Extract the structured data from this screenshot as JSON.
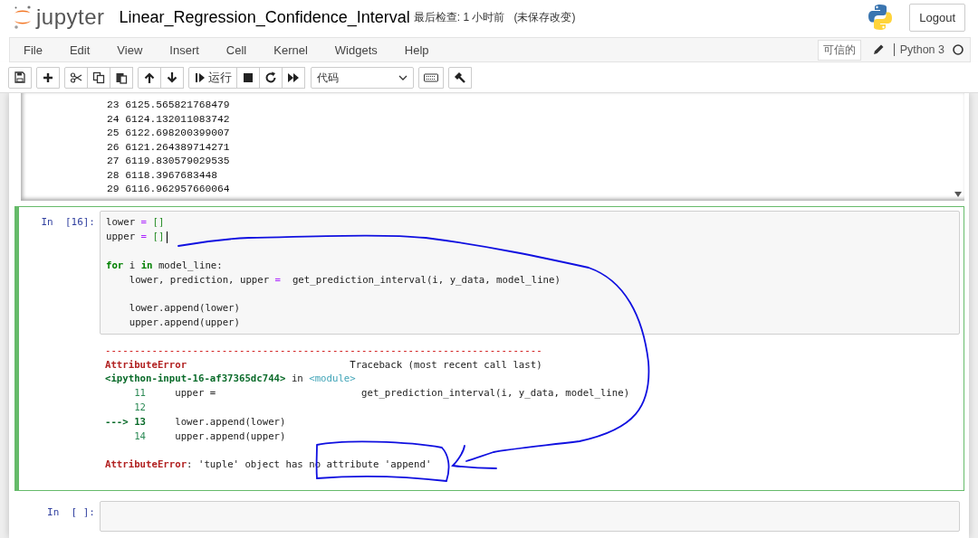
{
  "header": {
    "logo_text": "jupyter",
    "notebook_title": "Linear_Regression_Confidence_Interval",
    "checkpoint": "最后检查: 1 小时前",
    "unsaved": "(未保存改变)",
    "logout": "Logout"
  },
  "menu": {
    "items": [
      "File",
      "Edit",
      "View",
      "Insert",
      "Cell",
      "Kernel",
      "Widgets",
      "Help"
    ],
    "trusted": "可信的",
    "kernel_name": "Python 3",
    "kernel_busy": false
  },
  "toolbar": {
    "run_label": "运行",
    "cell_type": "代码"
  },
  "cells": [
    {
      "kind": "output_scroll",
      "output": [
        "23 6125.565821768479",
        "24 6124.132011083742",
        "25 6122.698200399007",
        "26 6121.264389714271",
        "27 6119.830579029535",
        "28 6118.3967683448",
        "29 6116.962957660064"
      ]
    },
    {
      "kind": "code",
      "selected": true,
      "prompt": "In  [16]:",
      "code": [
        {
          "kind": "line",
          "tokens": [
            {
              "text": "lower",
              "kind": "name"
            },
            {
              "text": " = ",
              "kind": "op"
            },
            {
              "text": "[]",
              "kind": "bracket"
            }
          ]
        },
        {
          "kind": "line",
          "tokens": [
            {
              "text": "upper",
              "kind": "name"
            },
            {
              "text": " = ",
              "kind": "op"
            },
            {
              "text": "[]",
              "kind": "bracket"
            }
          ]
        },
        {
          "kind": "blank"
        },
        {
          "kind": "line",
          "tokens": [
            {
              "text": "for",
              "kind": "keyword"
            },
            {
              "text": " i ",
              "kind": "name"
            },
            {
              "text": "in",
              "kind": "keyword"
            },
            {
              "text": " model_line:",
              "kind": "name"
            }
          ]
        },
        {
          "kind": "line",
          "tokens": [
            {
              "text": "    lower, prediction, upper ",
              "kind": "name"
            },
            {
              "text": "=",
              "kind": "op"
            },
            {
              "text": "  get_prediction_interval(i, y_data, model_line)",
              "kind": "name"
            }
          ]
        },
        {
          "kind": "blank"
        },
        {
          "kind": "line",
          "tokens": [
            {
              "text": "    lower.append(lower)",
              "kind": "name"
            }
          ]
        },
        {
          "kind": "line",
          "tokens": [
            {
              "text": "    upper.append(upper)",
              "kind": "name"
            }
          ]
        }
      ],
      "traceback": [
        {
          "kind": "line",
          "tokens": [
            {
              "text": "---------------------------------------------------------------------------",
              "kind": "rule"
            }
          ]
        },
        {
          "kind": "line",
          "tokens": [
            {
              "text": "AttributeError",
              "kind": "error"
            },
            {
              "text": "                            Traceback (most recent call last)",
              "kind": "name"
            }
          ]
        },
        {
          "kind": "line",
          "tokens": [
            {
              "text": "<ipython-input-16-af37365dc744>",
              "kind": "file"
            },
            {
              "text": " in ",
              "kind": "name"
            },
            {
              "text": "<module>",
              "kind": "module"
            }
          ]
        },
        {
          "kind": "line",
          "tokens": [
            {
              "text": "     11",
              "kind": "lineno"
            },
            {
              "text": "     upper =                         get_prediction_interval(i, y_data, model_line)",
              "kind": "name"
            }
          ]
        },
        {
          "kind": "line",
          "tokens": [
            {
              "text": "     12",
              "kind": "lineno"
            }
          ]
        },
        {
          "kind": "line",
          "tokens": [
            {
              "text": "---> 13",
              "kind": "current"
            },
            {
              "text": "     lower.append(lower)",
              "kind": "name"
            }
          ]
        },
        {
          "kind": "line",
          "tokens": [
            {
              "text": "     14",
              "kind": "lineno"
            },
            {
              "text": "     upper.append(upper)",
              "kind": "name"
            }
          ]
        },
        {
          "kind": "blank"
        },
        {
          "kind": "line",
          "tokens": [
            {
              "text": "AttributeError",
              "kind": "error"
            },
            {
              "text": ": 'tuple' object has no attribute 'append'",
              "kind": "name"
            }
          ]
        }
      ]
    },
    {
      "kind": "code",
      "selected": false,
      "prompt": "In  [ ]:"
    }
  ]
}
